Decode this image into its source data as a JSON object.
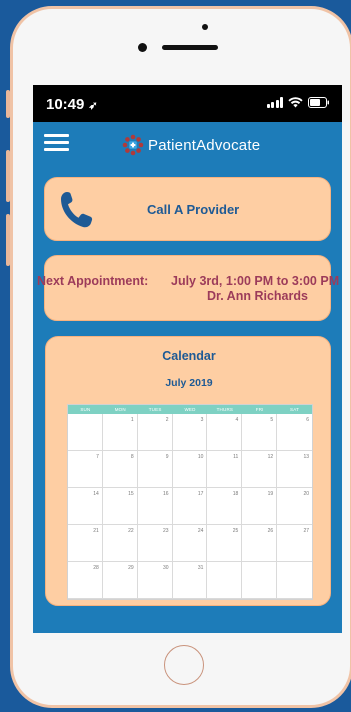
{
  "status_bar": {
    "time": "10:49"
  },
  "app_bar": {
    "brand": "PatientAdvocate"
  },
  "call_card": {
    "label": "Call A Provider"
  },
  "appointment_card": {
    "label": "Next Appointment:",
    "time": "July 3rd, 1:00 PM to 3:00 PM",
    "doctor": "Dr. Ann Richards"
  },
  "calendar": {
    "title": "Calendar",
    "month": "July 2019",
    "weekdays": [
      "SUN",
      "MON",
      "TUES",
      "WED",
      "THURS",
      "FRI",
      "SAT"
    ],
    "weeks": [
      [
        "",
        "1",
        "2",
        "3",
        "4",
        "5",
        "6"
      ],
      [
        "7",
        "8",
        "9",
        "10",
        "11",
        "12",
        "13"
      ],
      [
        "14",
        "15",
        "16",
        "17",
        "18",
        "19",
        "20"
      ],
      [
        "21",
        "22",
        "23",
        "24",
        "25",
        "26",
        "27"
      ],
      [
        "28",
        "29",
        "30",
        "31",
        "",
        "",
        ""
      ]
    ]
  },
  "colors": {
    "screen_bg": "#1d7cb9",
    "card_bg": "#fecea3",
    "heading_blue": "#1e5a95",
    "appointment_text": "#9c3b5a",
    "calendar_header": "#7ed1c3"
  }
}
